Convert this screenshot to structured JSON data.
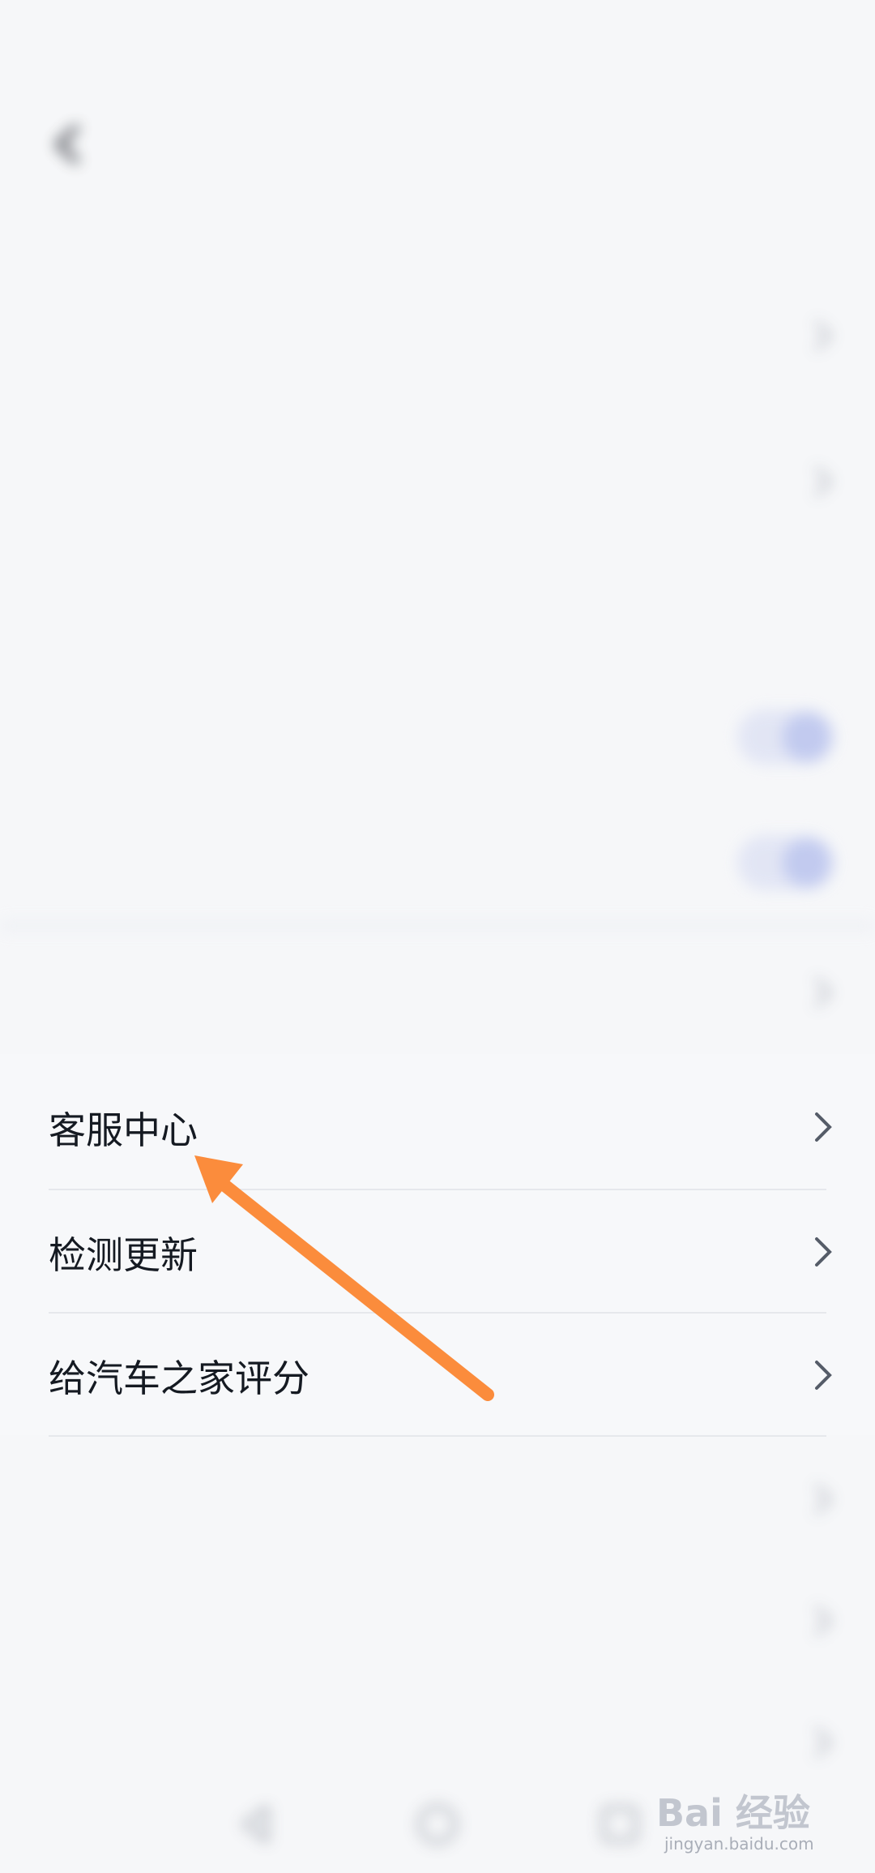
{
  "status_bar": {
    "left_text": "",
    "right_text": ""
  },
  "nav": {
    "title": ""
  },
  "subline": {
    "left": "",
    "right": ""
  },
  "blurred_rows": [
    {
      "label": "",
      "control": "chevron"
    },
    {
      "label": "",
      "control": "chevron"
    },
    {
      "label": "",
      "control": "none"
    },
    {
      "label": "",
      "control": "toggle"
    },
    {
      "label": "",
      "control": "toggle"
    },
    {
      "label": "",
      "control": "chevron"
    }
  ],
  "clear_rows": [
    {
      "label": "客服中心"
    },
    {
      "label": "检测更新"
    },
    {
      "label": "给汽车之家评分"
    }
  ],
  "lower_blurred_rows": [
    {
      "label": ""
    },
    {
      "label": ""
    },
    {
      "label": ""
    }
  ],
  "watermark": {
    "main": "Bai 经验",
    "sub": "jingyan.baidu.com"
  },
  "colors": {
    "annotation_arrow": "#fb8c3c",
    "toggle_accent": "#b9c3ee"
  }
}
